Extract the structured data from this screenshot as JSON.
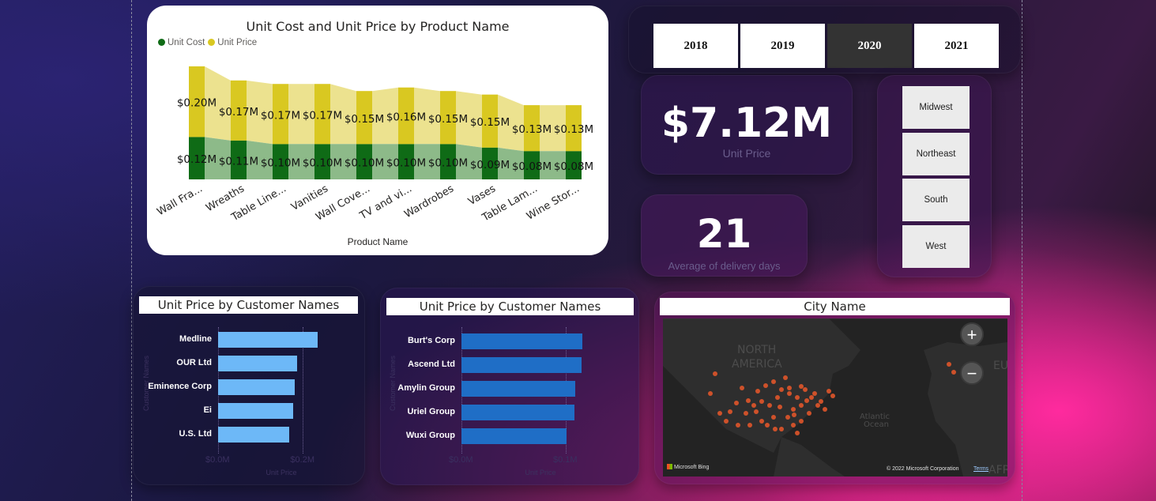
{
  "main_chart": {
    "title": "Unit Cost and Unit Price by Product Name",
    "legend": [
      {
        "name": "Unit Cost",
        "color": "#0f6b16"
      },
      {
        "name": "Unit Price",
        "color": "#d9c821"
      }
    ],
    "x_title": "Product Name"
  },
  "chart_data": [
    {
      "type": "bar",
      "title": "Unit Cost and Unit Price by Product Name",
      "xlabel": "Product Name",
      "ylabel": "",
      "categories": [
        "Wall Fra...",
        "Wreaths",
        "Table Line...",
        "Vanities",
        "Wall Cove...",
        "TV and vi...",
        "Wardrobes",
        "Vases",
        "Table Lam...",
        "Wine Stor..."
      ],
      "series": [
        {
          "name": "Unit Cost",
          "values": [
            0.12,
            0.11,
            0.1,
            0.1,
            0.1,
            0.1,
            0.1,
            0.09,
            0.08,
            0.08
          ],
          "labels": [
            "$0.12M",
            "$0.11M",
            "$0.10M",
            "$0.10M",
            "$0.10M",
            "$0.10M",
            "$0.10M",
            "$0.09M",
            "$0.08M",
            "$0.08M"
          ]
        },
        {
          "name": "Unit Price",
          "values": [
            0.2,
            0.17,
            0.17,
            0.17,
            0.15,
            0.16,
            0.15,
            0.15,
            0.13,
            0.13
          ],
          "labels": [
            "$0.20M",
            "$0.17M",
            "$0.17M",
            "$0.17M",
            "$0.15M",
            "$0.16M",
            "$0.15M",
            "$0.15M",
            "$0.13M",
            "$0.13M"
          ]
        }
      ],
      "stacked": true,
      "ylim": [
        0,
        0.32
      ],
      "grid": false,
      "legend_position": "top-left"
    },
    {
      "type": "bar",
      "orientation": "horizontal",
      "title": "Unit Price by Customer Names",
      "xlabel": "Unit Price",
      "ylabel": "Customer Names",
      "categories": [
        "Medline",
        "OUR Ltd",
        "Eminence Corp",
        "Ei",
        "U.S. Ltd"
      ],
      "values": [
        0.235,
        0.187,
        0.18,
        0.177,
        0.168
      ],
      "xlim": [
        0,
        0.27
      ],
      "ticks": [
        {
          "value": 0,
          "label": "$0.0M"
        },
        {
          "value": 0.2,
          "label": "$0.2M"
        }
      ],
      "color": "#6db8f7"
    },
    {
      "type": "bar",
      "orientation": "horizontal",
      "title": "Unit Price by Customer Names",
      "xlabel": "Unit Price",
      "ylabel": "Customer Names",
      "categories": [
        "Burt's Corp",
        "Ascend Ltd",
        "Amylin Group",
        "Uriel Group",
        "Wuxi Group"
      ],
      "values": [
        0.116,
        0.115,
        0.109,
        0.108,
        0.101
      ],
      "xlim": [
        0,
        0.125
      ],
      "ticks": [
        {
          "value": 0,
          "label": "$0.0M"
        },
        {
          "value": 0.1,
          "label": "$0.1M"
        }
      ],
      "color": "#1f6ec6"
    }
  ],
  "year_slicer": {
    "years": [
      {
        "label": "2018",
        "selected": false
      },
      {
        "label": "2019",
        "selected": false
      },
      {
        "label": "2020",
        "selected": true
      },
      {
        "label": "2021",
        "selected": false
      }
    ]
  },
  "kpi_price": {
    "value": "$7.12M",
    "label": "Unit Price"
  },
  "kpi_delivery": {
    "value": "21",
    "label": "Average of delivery days"
  },
  "region_slicer": {
    "items": [
      "Midwest",
      "Northeast",
      "South",
      "West"
    ]
  },
  "bar_left": {
    "title": "Unit Price by Customer Names",
    "xlabel": "Unit Price",
    "ylabel": "Customer Names"
  },
  "bar_mid": {
    "title": "Unit Price by Customer Names",
    "xlabel": "Unit Price",
    "ylabel": "Customer Names"
  },
  "map": {
    "title": "City Name",
    "zoom_in": "+",
    "zoom_out": "−",
    "label_na_1": "NORTH",
    "label_na_2": "AMERICA",
    "label_ocean_1": "Atlantic",
    "label_ocean_2": "Ocean",
    "label_eu": "EUR",
    "label_afr": "AFR",
    "bing": "Microsoft Bing",
    "copyright": "© 2022 Microsoft Corporation",
    "terms": "Terms",
    "point_color": "#e0552a"
  }
}
